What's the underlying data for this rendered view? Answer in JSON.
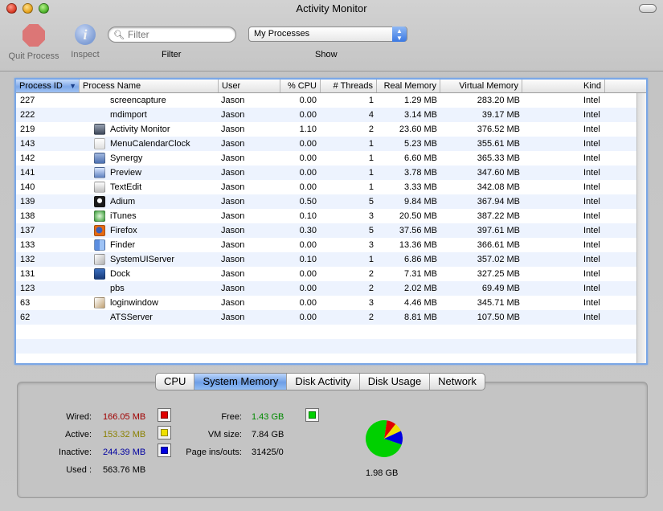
{
  "window": {
    "title": "Activity Monitor"
  },
  "toolbar": {
    "quit_label": "Quit Process",
    "inspect_label": "Inspect",
    "filter_placeholder": "Filter",
    "filter_label": "Filter",
    "show_value": "My Processes",
    "show_label": "Show"
  },
  "table": {
    "columns": [
      "Process ID",
      "Process Name",
      "User",
      "% CPU",
      "# Threads",
      "Real Memory",
      "Virtual Memory",
      "Kind"
    ],
    "sorted_column": "Process ID",
    "rows": [
      {
        "pid": "227",
        "name": "screencapture",
        "icon": "none",
        "user": "Jason",
        "cpu": "0.00",
        "threads": "1",
        "real": "1.29 MB",
        "virtual": "283.20 MB",
        "kind": "Intel"
      },
      {
        "pid": "222",
        "name": "mdimport",
        "icon": "none",
        "user": "Jason",
        "cpu": "0.00",
        "threads": "4",
        "real": "3.14 MB",
        "virtual": "39.17 MB",
        "kind": "Intel"
      },
      {
        "pid": "219",
        "name": "Activity Monitor",
        "icon": "activity-monitor-icon",
        "user": "Jason",
        "cpu": "1.10",
        "threads": "2",
        "real": "23.60 MB",
        "virtual": "376.52 MB",
        "kind": "Intel"
      },
      {
        "pid": "143",
        "name": "MenuCalendarClock",
        "icon": "calendar-icon",
        "user": "Jason",
        "cpu": "0.00",
        "threads": "1",
        "real": "5.23 MB",
        "virtual": "355.61 MB",
        "kind": "Intel"
      },
      {
        "pid": "142",
        "name": "Synergy",
        "icon": "synergy-icon",
        "user": "Jason",
        "cpu": "0.00",
        "threads": "1",
        "real": "6.60 MB",
        "virtual": "365.33 MB",
        "kind": "Intel"
      },
      {
        "pid": "141",
        "name": "Preview",
        "icon": "preview-icon",
        "user": "Jason",
        "cpu": "0.00",
        "threads": "1",
        "real": "3.78 MB",
        "virtual": "347.60 MB",
        "kind": "Intel"
      },
      {
        "pid": "140",
        "name": "TextEdit",
        "icon": "textedit-icon",
        "user": "Jason",
        "cpu": "0.00",
        "threads": "1",
        "real": "3.33 MB",
        "virtual": "342.08 MB",
        "kind": "Intel"
      },
      {
        "pid": "139",
        "name": "Adium",
        "icon": "adium-icon",
        "user": "Jason",
        "cpu": "0.50",
        "threads": "5",
        "real": "9.84 MB",
        "virtual": "367.94 MB",
        "kind": "Intel"
      },
      {
        "pid": "138",
        "name": "iTunes",
        "icon": "itunes-icon",
        "user": "Jason",
        "cpu": "0.10",
        "threads": "3",
        "real": "20.50 MB",
        "virtual": "387.22 MB",
        "kind": "Intel"
      },
      {
        "pid": "137",
        "name": "Firefox",
        "icon": "firefox-icon",
        "user": "Jason",
        "cpu": "0.30",
        "threads": "5",
        "real": "37.56 MB",
        "virtual": "397.61 MB",
        "kind": "Intel"
      },
      {
        "pid": "133",
        "name": "Finder",
        "icon": "finder-icon",
        "user": "Jason",
        "cpu": "0.00",
        "threads": "3",
        "real": "13.36 MB",
        "virtual": "366.61 MB",
        "kind": "Intel"
      },
      {
        "pid": "132",
        "name": "SystemUIServer",
        "icon": "systemuiserver-icon",
        "user": "Jason",
        "cpu": "0.10",
        "threads": "1",
        "real": "6.86 MB",
        "virtual": "357.02 MB",
        "kind": "Intel"
      },
      {
        "pid": "131",
        "name": "Dock",
        "icon": "dock-icon",
        "user": "Jason",
        "cpu": "0.00",
        "threads": "2",
        "real": "7.31 MB",
        "virtual": "327.25 MB",
        "kind": "Intel"
      },
      {
        "pid": "123",
        "name": "pbs",
        "icon": "none",
        "user": "Jason",
        "cpu": "0.00",
        "threads": "2",
        "real": "2.02 MB",
        "virtual": "69.49 MB",
        "kind": "Intel"
      },
      {
        "pid": "63",
        "name": "loginwindow",
        "icon": "loginwindow-icon",
        "user": "Jason",
        "cpu": "0.00",
        "threads": "3",
        "real": "4.46 MB",
        "virtual": "345.71 MB",
        "kind": "Intel"
      },
      {
        "pid": "62",
        "name": "ATSServer",
        "icon": "none",
        "user": "Jason",
        "cpu": "0.00",
        "threads": "2",
        "real": "8.81 MB",
        "virtual": "107.50 MB",
        "kind": "Intel"
      }
    ]
  },
  "tabs": [
    {
      "label": "CPU",
      "active": false
    },
    {
      "label": "System Memory",
      "active": true
    },
    {
      "label": "Disk Activity",
      "active": false
    },
    {
      "label": "Disk Usage",
      "active": false
    },
    {
      "label": "Network",
      "active": false
    }
  ],
  "memory": {
    "wired_label": "Wired:",
    "wired_value": "166.05 MB",
    "wired_color": "#e00000",
    "active_label": "Active:",
    "active_value": "153.32 MB",
    "active_color": "#f0e000",
    "inactive_label": "Inactive:",
    "inactive_value": "244.39 MB",
    "inactive_color": "#0000e0",
    "used_label": "Used :",
    "used_value": "563.76 MB",
    "free_label": "Free:",
    "free_value": "1.43 GB",
    "free_color": "#00d000",
    "vmsize_label": "VM size:",
    "vmsize_value": "7.84 GB",
    "pageins_label": "Page ins/outs:",
    "pageins_value": "31425/0",
    "total_value": "1.98 GB",
    "value_colors": {
      "wired": "#a00000",
      "active": "#8a8000",
      "inactive": "#0000a0",
      "free": "#008a00"
    }
  }
}
